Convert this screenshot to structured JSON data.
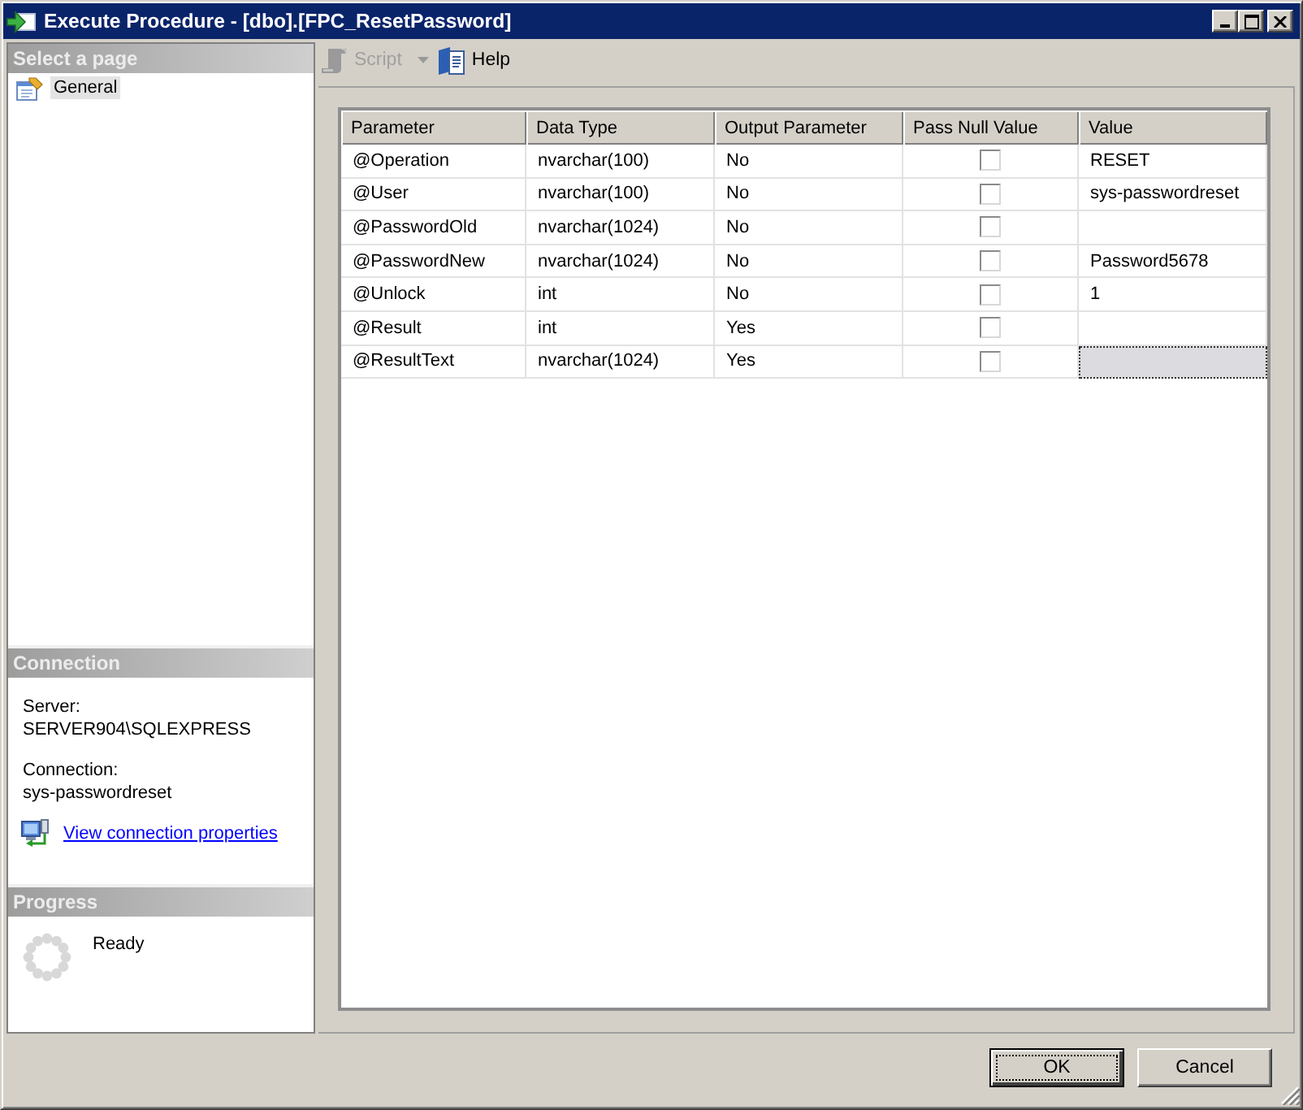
{
  "window": {
    "title": "Execute Procedure - [dbo].[FPC_ResetPassword]"
  },
  "sidebar": {
    "header": "Select a page",
    "pages": [
      {
        "label": "General",
        "selected": true
      }
    ]
  },
  "connection": {
    "header": "Connection",
    "server_label": "Server:",
    "server": "SERVER904\\SQLEXPRESS",
    "connection_label": "Connection:",
    "connection": "sys-passwordreset",
    "link": "View connection properties"
  },
  "progress": {
    "header": "Progress",
    "status": "Ready"
  },
  "toolbar": [
    {
      "kind": "script",
      "label": "Script",
      "disabled": true
    },
    {
      "kind": "help",
      "label": "Help",
      "disabled": false
    }
  ],
  "table": {
    "columns": [
      "Parameter",
      "Data Type",
      "Output Parameter",
      "Pass Null Value",
      "Value"
    ],
    "rows": [
      {
        "parameter": "@Operation",
        "data_type": "nvarchar(100)",
        "output_parameter": "No",
        "pass_null": false,
        "value": "RESET",
        "selected": false
      },
      {
        "parameter": "@User",
        "data_type": "nvarchar(100)",
        "output_parameter": "No",
        "pass_null": false,
        "value": "sys-passwordreset",
        "selected": false
      },
      {
        "parameter": "@PasswordOld",
        "data_type": "nvarchar(1024)",
        "output_parameter": "No",
        "pass_null": false,
        "selected": false
      },
      {
        "parameter": "@PasswordNew",
        "data_type": "nvarchar(1024)",
        "output_parameter": "No",
        "pass_null": false,
        "value": "Password5678",
        "selected": false
      },
      {
        "parameter": "@Unlock",
        "data_type": "int",
        "output_parameter": "No",
        "pass_null": false,
        "value": "1",
        "selected": false
      },
      {
        "parameter": "@Result",
        "data_type": "int",
        "output_parameter": "Yes",
        "pass_null": false,
        "selected": false
      },
      {
        "parameter": "@ResultText",
        "data_type": "nvarchar(1024)",
        "output_parameter": "Yes",
        "pass_null": false,
        "selected": true
      }
    ]
  },
  "buttons": [
    {
      "label": "OK",
      "default": true
    },
    {
      "label": "Cancel",
      "default": false
    }
  ]
}
